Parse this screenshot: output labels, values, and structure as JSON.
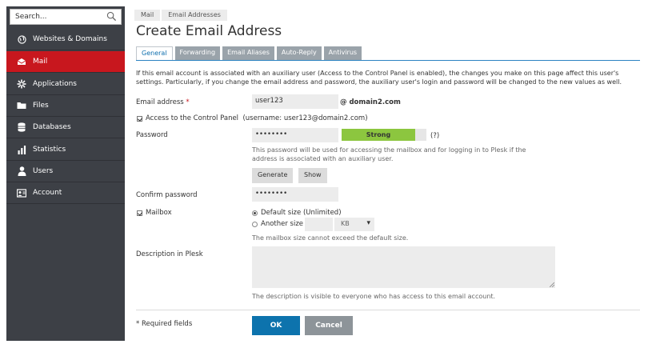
{
  "sidebar": {
    "search_placeholder": "Search...",
    "items": [
      {
        "label": "Websites & Domains",
        "icon": "globe-icon"
      },
      {
        "label": "Mail",
        "icon": "mail-icon",
        "active": true
      },
      {
        "label": "Applications",
        "icon": "gear-icon"
      },
      {
        "label": "Files",
        "icon": "folder-icon"
      },
      {
        "label": "Databases",
        "icon": "database-icon"
      },
      {
        "label": "Statistics",
        "icon": "bar-chart-icon"
      },
      {
        "label": "Users",
        "icon": "user-icon"
      },
      {
        "label": "Account",
        "icon": "account-icon"
      }
    ]
  },
  "breadcrumb": [
    "Mail",
    "Email Addresses"
  ],
  "page_title": "Create Email Address",
  "tabs": [
    "General",
    "Forwarding",
    "Email Aliases",
    "Auto-Reply",
    "Antivirus"
  ],
  "active_tab": "General",
  "intro_text": "If this email account is associated with an auxiliary user (Access to the Control Panel is enabled), the changes you make on this page affect this user's settings. Particularly, if you change the email address and password, the auxiliary user's login and password will be changed to the new values as well.",
  "form": {
    "email_label": "Email address",
    "required_mark": "*",
    "email_value": "user123",
    "domain": "@ domain2.com",
    "cp_access_label": "Access to the Control Panel",
    "cp_access_detail": "(username: user123@domain2.com)",
    "cp_access_checked": true,
    "password_label": "Password",
    "password_value": "••••••••",
    "strength_label": "Strong",
    "strength_fraction": 0.87,
    "help_mark": "(?)",
    "password_hint": "This password will be used for accessing the mailbox and for logging in to Plesk if the address is associated with an auxiliary user.",
    "generate_label": "Generate",
    "show_label": "Show",
    "confirm_label": "Confirm password",
    "confirm_value": "••••••••",
    "mailbox_label": "Mailbox",
    "mailbox_checked": true,
    "default_size_label": "Default size (Unlimited)",
    "another_size_label": "Another size",
    "size_unit": "KB",
    "mailbox_hint": "The mailbox size cannot exceed the default size.",
    "description_label": "Description in Plesk",
    "description_value": "",
    "description_hint": "The description is visible to everyone who has access to this email account.",
    "required_note": "* Required fields",
    "ok_label": "OK",
    "cancel_label": "Cancel"
  },
  "colors": {
    "sidebar_bg": "#3d4046",
    "active_nav": "#c8171e",
    "primary_button": "#0d73ad",
    "strength_bar": "#8cc63f"
  }
}
